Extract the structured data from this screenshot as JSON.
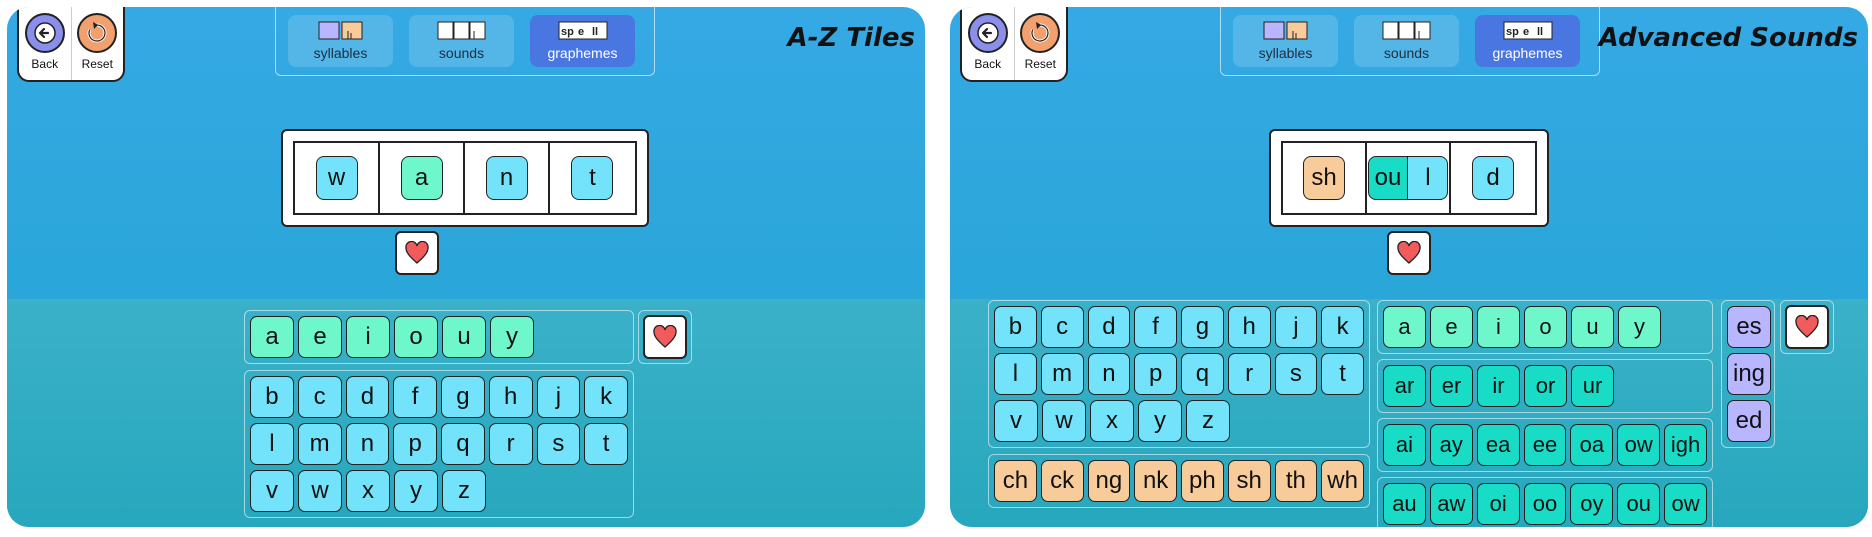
{
  "controls": {
    "back": "Back",
    "reset": "Reset"
  },
  "modes": {
    "syllables": "syllables",
    "sounds": "sounds",
    "graphemes": "graphemes",
    "graphemes_icon_text": [
      "sp",
      "e",
      "ll"
    ]
  },
  "left": {
    "title": "A-Z Tiles",
    "board": [
      "w",
      "a",
      "n",
      "t"
    ],
    "vowels": [
      "a",
      "e",
      "i",
      "o",
      "u",
      "y"
    ],
    "consonants": [
      [
        "b",
        "c",
        "d",
        "f",
        "g",
        "h",
        "j",
        "k"
      ],
      [
        "l",
        "m",
        "n",
        "p",
        "q",
        "r",
        "s",
        "t"
      ],
      [
        "v",
        "w",
        "x",
        "y",
        "z"
      ]
    ]
  },
  "right": {
    "title": "Advanced Sounds",
    "board": [
      [
        "sh"
      ],
      [
        "ou",
        "l"
      ],
      [
        "d"
      ]
    ],
    "consonants": [
      [
        "b",
        "c",
        "d",
        "f",
        "g",
        "h",
        "j",
        "k"
      ],
      [
        "l",
        "m",
        "n",
        "p",
        "q",
        "r",
        "s",
        "t"
      ],
      [
        "v",
        "w",
        "x",
        "y",
        "z"
      ]
    ],
    "digraphs": [
      "ch",
      "ck",
      "ng",
      "nk",
      "ph",
      "sh",
      "th",
      "wh"
    ],
    "vowels": [
      "a",
      "e",
      "i",
      "o",
      "u",
      "y"
    ],
    "r_controlled": [
      "ar",
      "er",
      "ir",
      "or",
      "ur"
    ],
    "vowel_teams": [
      "ai",
      "ay",
      "ea",
      "ee",
      "oa",
      "ow",
      "igh"
    ],
    "diphthongs": [
      "au",
      "aw",
      "oi",
      "oo",
      "oy",
      "ou",
      "ow"
    ],
    "suffixes": [
      "es",
      "ing",
      "ed"
    ]
  },
  "colors": {
    "consonant": "#73e3fb",
    "vowel": "#6ff7cc",
    "digraph": "#f8cb9a",
    "team": "#19dcc6",
    "suffix": "#b8b6ff",
    "active_mode": "#4a76e2"
  },
  "icons": [
    "back-arrow-icon",
    "reset-icon",
    "heart-icon",
    "syllables-icon",
    "sounds-icon",
    "graphemes-icon"
  ]
}
